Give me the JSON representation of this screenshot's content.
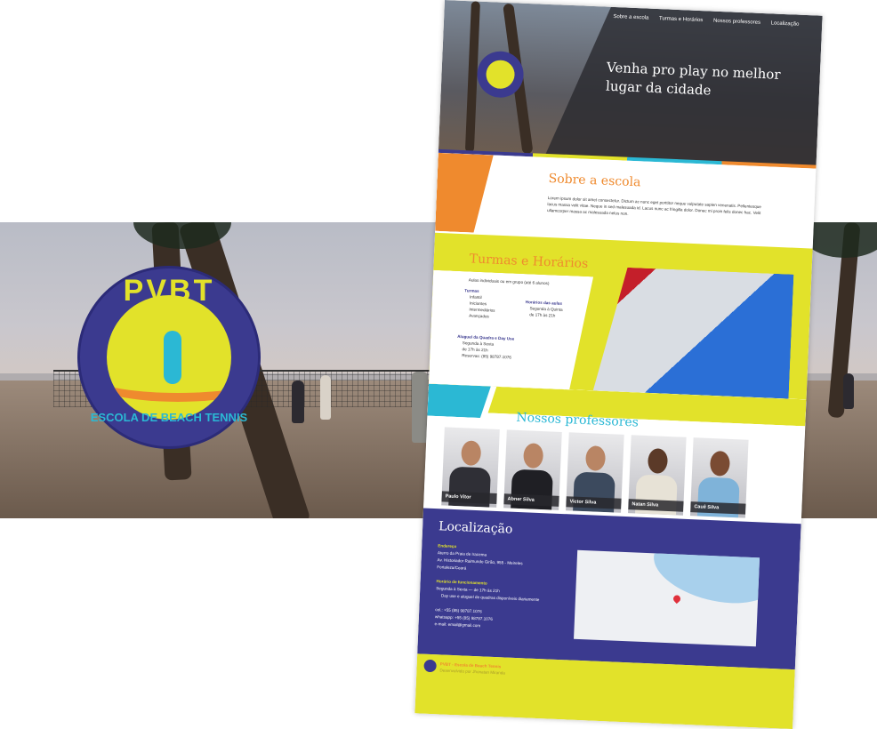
{
  "logo": {
    "title": "PVBT",
    "subtitle": "ESCOLA DE BEACH TENNIS"
  },
  "site": {
    "nav": [
      "Sobre a escola",
      "Turmas e Horários",
      "Nossos professores",
      "Localização"
    ],
    "hero_title": "Venha pro play no melhor lugar da cidade",
    "about": {
      "title": "Sobre a escola",
      "text": "Lorem ipsum dolor sit amet consectetur. Dictum ac nunc eget porttitor neque vulputate sapien venenatis. Pellentesque lacus massa velit vitae. Neque in sed malesuada id. Lacus nunc ac fringilla dolor. Donec mi proin felis donec hac. Velit ullamcorper massa ac malesuada netus non."
    },
    "classes": {
      "title": "Turmas e Horários",
      "intro": "Aulas individuais ou em grupo (até 6 alunos)",
      "turmas_label": "Turmas",
      "turmas": [
        "Infantil",
        "Iniciantes",
        "Intermediários",
        "Avançados"
      ],
      "horarios_label": "Horários das aulas",
      "horarios": [
        "Segunda à Quinta",
        "de 17h às 21h"
      ],
      "aluguel_label": "Aluguel da Quadra e Day Use",
      "aluguel": [
        "Segunda à Sexta",
        "de 17h às 21h",
        "Reservas: (85) 98787.1076"
      ]
    },
    "teachers": {
      "title": "Nossos professores",
      "names": [
        "Paulo Vitor",
        "Abner Silva",
        "Victor Silva",
        "Natan Silva",
        "Cauê Silva"
      ]
    },
    "location": {
      "title": "Localização",
      "address_label": "Endereço",
      "address_lines": [
        "Aterro da Praia de Iracema",
        "Av. Historiador Raimundo Girão, 955 - Meireles",
        "Fortaleza/Ceará"
      ],
      "hours_label": "Horário de funcionamento",
      "hours_lines": [
        "Segunda à Sexta — de 17h às 21h",
        "Day use e aluguel de quadras disponíveis diariamente"
      ],
      "cel": "cel.: +55 (85) 98787.1076",
      "whatsapp": "whatsapp: +55 (85) 98787.1076",
      "email": "e-mail: email@gmail.com"
    },
    "footer": {
      "brand": "PVBT - Escola de Beach Tennis",
      "tagline": "Desenvolvido por Jhonatan Miranda"
    }
  },
  "colors": {
    "navy": "#3b3a8f",
    "yellow": "#e2e22a",
    "cyan": "#2bb8d4",
    "orange": "#ef8a2e"
  }
}
